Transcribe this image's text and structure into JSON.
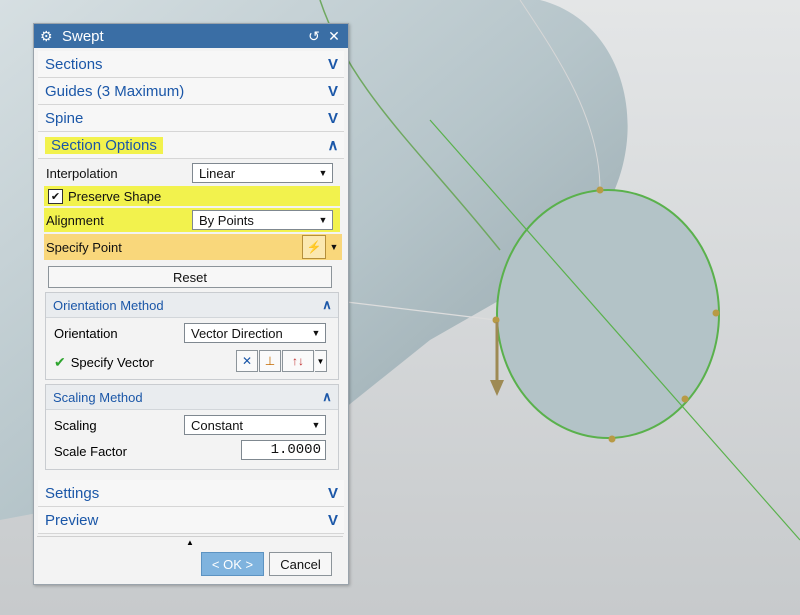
{
  "dialog": {
    "title": "Swept",
    "icons": {
      "title_icon": "gear-icon",
      "reset_icon": "reset-icon",
      "close_icon": "close-icon"
    },
    "sections": {
      "sections": "Sections",
      "guides": "Guides (3 Maximum)",
      "spine": "Spine",
      "section_options": "Section Options",
      "settings": "Settings",
      "preview": "Preview"
    },
    "section_options": {
      "interpolation_label": "Interpolation",
      "interpolation_value": "Linear",
      "preserve_shape_label": "Preserve Shape",
      "preserve_shape_checked": true,
      "alignment_label": "Alignment",
      "alignment_value": "By Points",
      "specify_point_label": "Specify Point",
      "reset_label": "Reset"
    },
    "orientation_method": {
      "header": "Orientation Method",
      "orientation_label": "Orientation",
      "orientation_value": "Vector Direction",
      "specify_vector_label": "Specify Vector"
    },
    "scaling_method": {
      "header": "Scaling Method",
      "scaling_label": "Scaling",
      "scaling_value": "Constant",
      "scale_factor_label": "Scale Factor",
      "scale_factor_value": "1.0000"
    },
    "footer": {
      "ok_label": "< OK >",
      "cancel_label": "Cancel"
    }
  },
  "colors": {
    "title_bar": "#3a6ea5",
    "section_label": "#1b57a8",
    "highlight": "#f2f24d",
    "active_row": "#f9d77b",
    "ok_button": "#7fb3de",
    "model_surface": "#b9c7cc",
    "curve_green": "#5ab14c"
  }
}
